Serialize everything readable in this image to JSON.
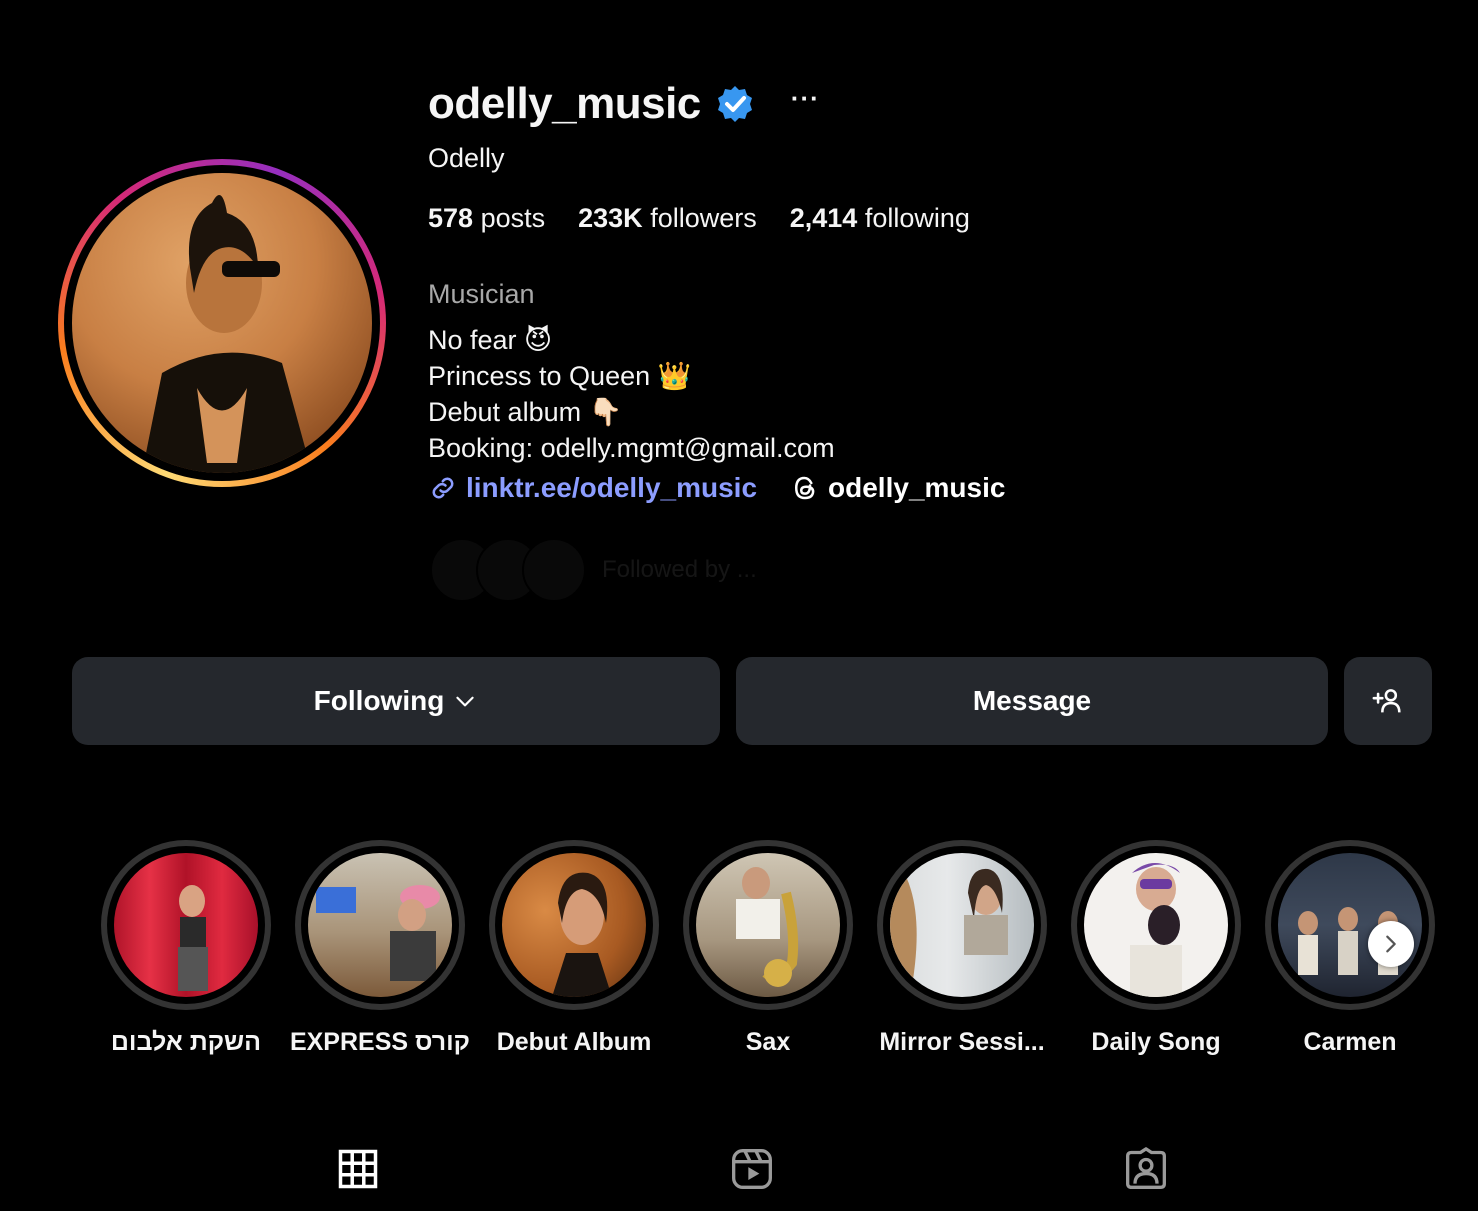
{
  "profile": {
    "username": "odelly_music",
    "full_name": "Odelly",
    "verified_icon": "verified-badge-icon",
    "more_label": "···",
    "stats": {
      "posts_count": "578",
      "posts_label": "posts",
      "followers_count": "233K",
      "followers_label": "followers",
      "following_count": "2,414",
      "following_label": "following"
    },
    "category": "Musician",
    "bio": [
      "No fear 😈",
      "Princess to Queen 👑",
      "Debut album 👇🏻",
      "Booking: odelly.mgmt@gmail.com"
    ],
    "link_text": "linktr.ee/odelly_music",
    "threads_handle": "odelly_music",
    "mutual_text": "Followed by ..."
  },
  "actions": {
    "following_label": "Following",
    "message_label": "Message",
    "add_icon": "add-person-icon"
  },
  "highlights": [
    {
      "label": "השקת אלבום"
    },
    {
      "label": "EXPRESS קורס"
    },
    {
      "label": "Debut Album"
    },
    {
      "label": "Sax"
    },
    {
      "label": "Mirror Sessi..."
    },
    {
      "label": "Daily Song"
    },
    {
      "label": "Carmen"
    }
  ],
  "tabs": [
    "grid-icon",
    "reels-icon",
    "tagged-icon"
  ],
  "colors": {
    "background": "#000000",
    "link": "#8c9dff",
    "button_bg": "#25282d",
    "verified": "#3897f0"
  }
}
